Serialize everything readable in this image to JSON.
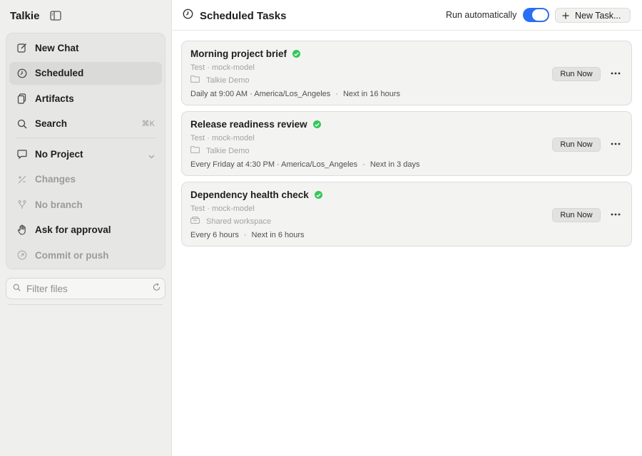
{
  "app": {
    "title": "Talkie"
  },
  "sidebar": {
    "menu": [
      {
        "label": "New Chat",
        "icon": "compose-icon"
      },
      {
        "label": "Scheduled",
        "icon": "clock-icon",
        "active": true
      },
      {
        "label": "Artifacts",
        "icon": "documents-icon"
      },
      {
        "label": "Search",
        "icon": "search-icon",
        "shortcut": "⌘K"
      }
    ],
    "context": [
      {
        "label": "No Project",
        "icon": "chat-bubble-icon"
      },
      {
        "label": "Changes",
        "icon": "diff-icon",
        "disabled": true
      },
      {
        "label": "No branch",
        "icon": "branch-icon",
        "disabled": true
      },
      {
        "label": "Ask for approval",
        "icon": "hand-icon"
      },
      {
        "label": "Commit or push",
        "icon": "commit-icon",
        "disabled": true
      }
    ],
    "filter": {
      "placeholder": "Filter files",
      "value": ""
    }
  },
  "main": {
    "title": "Scheduled Tasks",
    "run_automatically_label": "Run automatically",
    "run_automatically": true,
    "new_task_label": "New Task...",
    "tasks": [
      {
        "title": "Morning project brief",
        "status": "active",
        "meta": "Test · mock-model",
        "workspace": "Talkie Demo",
        "workspace_icon": "folder-icon",
        "schedule": "Daily at 9:00 AM · America/Los_Angeles",
        "next": "Next in 16 hours",
        "run_label": "Run Now"
      },
      {
        "title": "Release readiness review",
        "status": "active",
        "meta": "Test · mock-model",
        "workspace": "Talkie Demo",
        "workspace_icon": "folder-icon",
        "schedule": "Every Friday at 4:30 PM · America/Los_Angeles",
        "next": "Next in 3 days",
        "run_label": "Run Now"
      },
      {
        "title": "Dependency health check",
        "status": "active",
        "meta": "Test · mock-model",
        "workspace": "Shared workspace",
        "workspace_icon": "drawer-icon",
        "schedule": "Every 6 hours",
        "next": "Next in 6 hours",
        "run_label": "Run Now"
      }
    ]
  },
  "colors": {
    "accent": "#2a6ef5",
    "status_ok": "#34c759",
    "sidebar_bg": "#efefee"
  }
}
